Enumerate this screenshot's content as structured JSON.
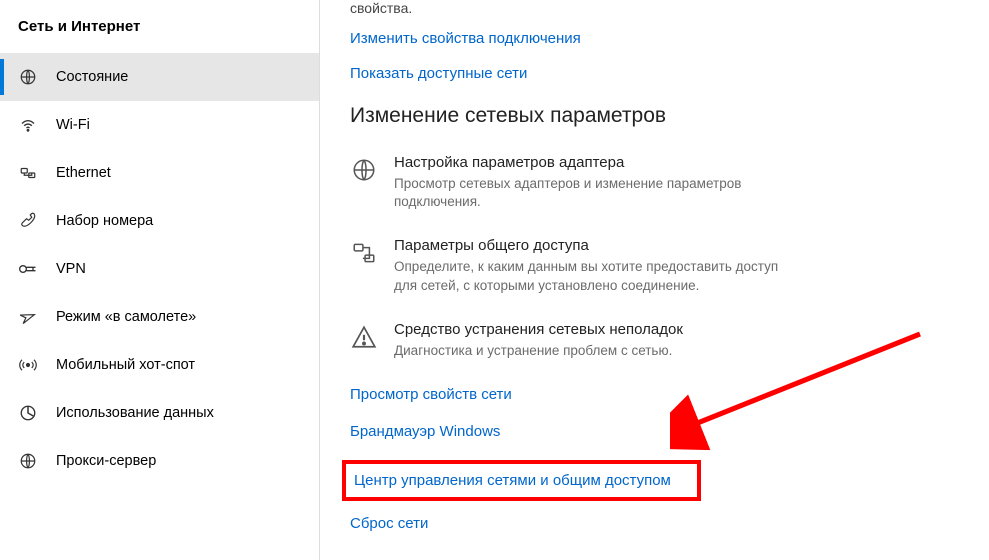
{
  "sidebar": {
    "title": "Сеть и Интернет",
    "items": [
      {
        "id": "status",
        "label": "Состояние",
        "icon": "globe-icon",
        "selected": true
      },
      {
        "id": "wifi",
        "label": "Wi-Fi",
        "icon": "wifi-icon",
        "selected": false
      },
      {
        "id": "ethernet",
        "label": "Ethernet",
        "icon": "ethernet-icon",
        "selected": false
      },
      {
        "id": "dialup",
        "label": "Набор номера",
        "icon": "dialup-icon",
        "selected": false
      },
      {
        "id": "vpn",
        "label": "VPN",
        "icon": "vpn-icon",
        "selected": false
      },
      {
        "id": "airplane",
        "label": "Режим «в самолете»",
        "icon": "airplane-icon",
        "selected": false
      },
      {
        "id": "hotspot",
        "label": "Мобильный хот-спот",
        "icon": "hotspot-icon",
        "selected": false
      },
      {
        "id": "datausage",
        "label": "Использование данных",
        "icon": "data-usage-icon",
        "selected": false
      },
      {
        "id": "proxy",
        "label": "Прокси-сервер",
        "icon": "proxy-icon",
        "selected": false
      }
    ]
  },
  "content": {
    "truncated_top": "свойства.",
    "link_change_conn": "Изменить свойства подключения",
    "link_show_networks": "Показать доступные сети",
    "section_heading": "Изменение сетевых параметров",
    "options": [
      {
        "id": "adapter",
        "title": "Настройка параметров адаптера",
        "desc": "Просмотр сетевых адаптеров и изменение параметров подключения.",
        "icon": "adapter-icon"
      },
      {
        "id": "sharing",
        "title": "Параметры общего доступа",
        "desc": "Определите, к каким данным вы хотите предоставить доступ для сетей, с которыми установлено соединение.",
        "icon": "sharing-icon"
      },
      {
        "id": "troubleshoot",
        "title": "Средство устранения сетевых неполадок",
        "desc": "Диагностика и устранение проблем с сетью.",
        "icon": "troubleshoot-icon"
      }
    ],
    "bottom_links": {
      "view_props": "Просмотр свойств сети",
      "firewall": "Брандмауэр Windows",
      "sharing_center": "Центр управления сетями и общим доступом",
      "reset": "Сброс сети"
    }
  }
}
